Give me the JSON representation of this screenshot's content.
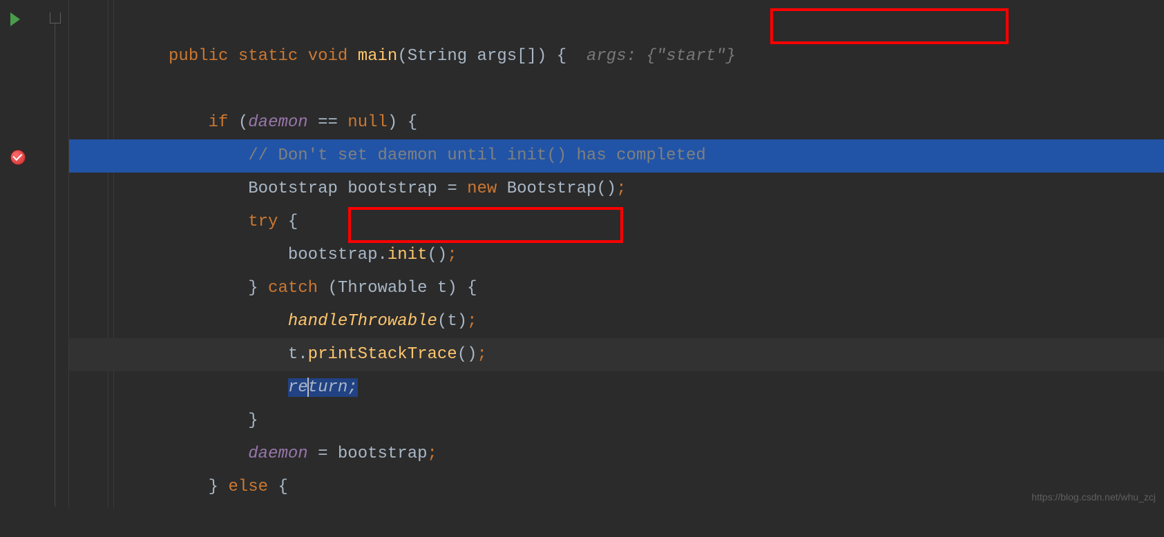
{
  "code": {
    "line1": {
      "kw_public": "public",
      "kw_static": "static",
      "kw_void": "void",
      "method": "main",
      "paren_open": "(",
      "type_string": "String",
      "param": " args",
      "brackets": "[]",
      "paren_close": ")",
      "brace": " {",
      "hint_args": "args: ",
      "hint_brace_open": "{",
      "hint_str": "\"start\"",
      "hint_brace_close": "}"
    },
    "line3": {
      "kw_if": "if",
      "paren_open": " (",
      "field": "daemon",
      "op_eq": " == ",
      "kw_null": "null",
      "paren_close": ")",
      "brace": " {"
    },
    "line4": {
      "comment": "// Don't set daemon until init() has completed"
    },
    "line5": {
      "type1": "Bootstrap ",
      "var": "bootstrap ",
      "op": "= ",
      "kw_new": "new",
      "type2": " Bootstrap",
      "parens": "()",
      "semi": ";"
    },
    "line6": {
      "kw_try": "try",
      "brace": " {"
    },
    "line7": {
      "var": "bootstrap.",
      "method": "init",
      "parens": "()",
      "semi": ";"
    },
    "line8": {
      "brace_close": "}",
      "kw_catch": " catch",
      "paren_open": " (",
      "type": "Throwable ",
      "var": "t",
      "paren_close": ")",
      "brace": " {"
    },
    "line9": {
      "method": "handleThrowable",
      "paren_open": "(",
      "arg": "t",
      "paren_close": ")",
      "semi": ";"
    },
    "line10": {
      "var": "t.",
      "method": "printStackTrace",
      "parens": "()",
      "semi": ";"
    },
    "line11": {
      "kw_return_pre": "re",
      "kw_return_post": "turn;"
    },
    "line12": {
      "brace": "}"
    },
    "line13": {
      "field": "daemon",
      "op": " = ",
      "var": "bootstrap",
      "semi": ";"
    },
    "line14": {
      "brace_close": "}",
      "kw_else": " else",
      "brace": " {"
    }
  },
  "watermark": "https://blog.csdn.net/whu_zcj",
  "indent": {
    "i1": "    ",
    "i2": "        ",
    "i3": "            ",
    "i4": "                "
  }
}
